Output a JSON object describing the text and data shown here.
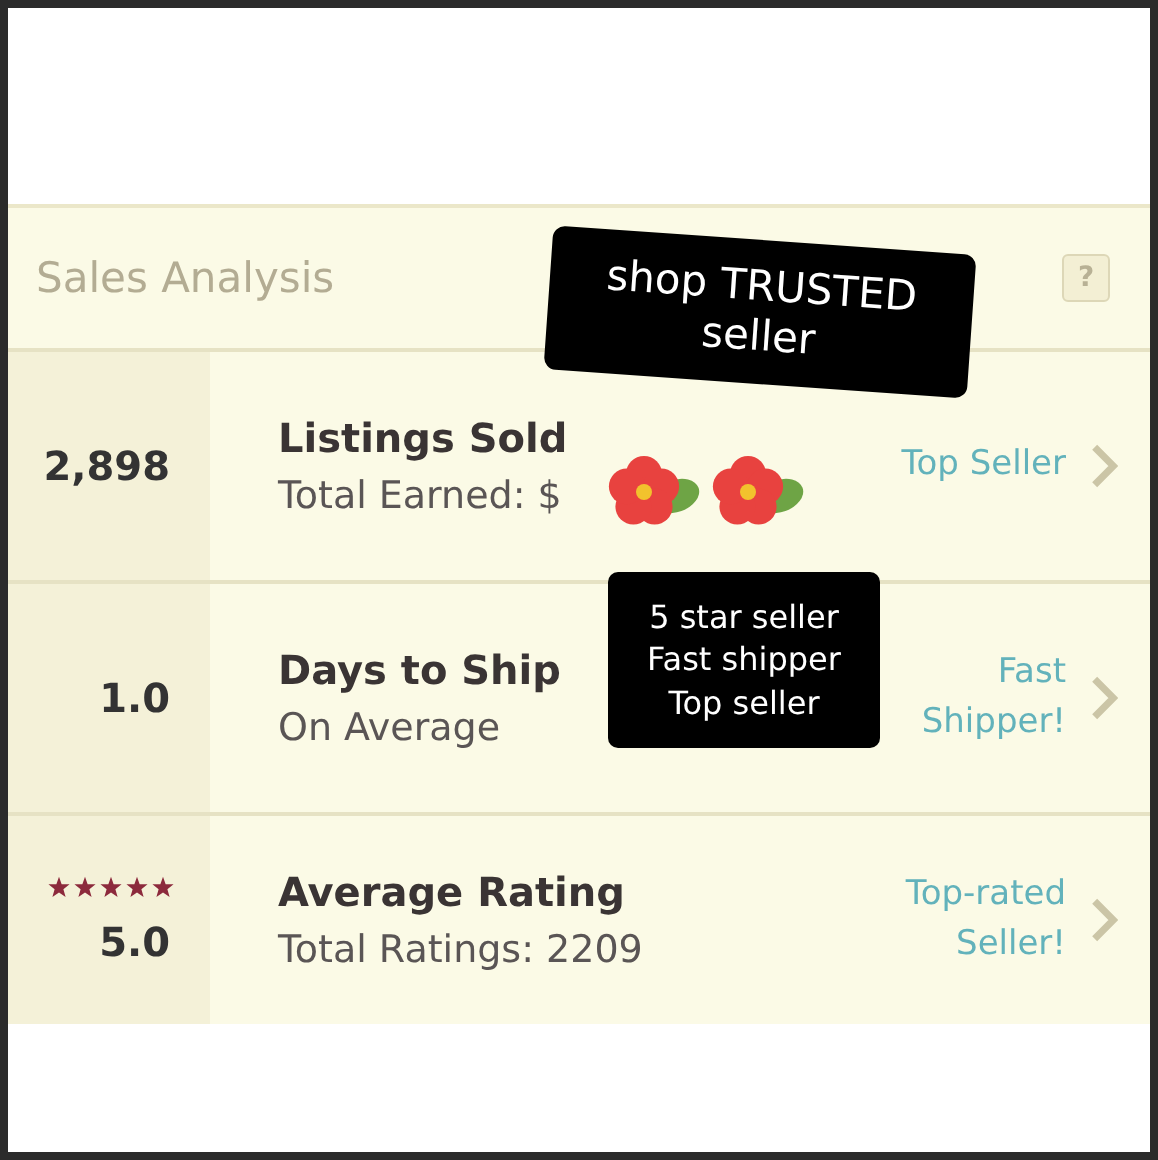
{
  "panel": {
    "title": "Sales Analysis",
    "help": "?"
  },
  "rows": [
    {
      "kind": "count",
      "value": "2,898",
      "label": "Listings Sold",
      "sublabel": "Total Earned: $",
      "badge": "Top Seller"
    },
    {
      "kind": "count",
      "value": "1.0",
      "label": "Days to Ship",
      "sublabel": "On Average",
      "badge": "Fast Shipper!"
    },
    {
      "kind": "rating",
      "stars": 5,
      "value": "5.0",
      "label": "Average Rating",
      "sublabel": "Total Ratings: 2209",
      "badge": "Top-rated Seller!"
    }
  ],
  "stickers": [
    {
      "kind": "label",
      "text": "shop TRUSTED seller"
    },
    {
      "kind": "flowers"
    },
    {
      "kind": "note",
      "lines": [
        "5 star seller",
        "Fast shipper",
        "Top seller"
      ]
    }
  ]
}
